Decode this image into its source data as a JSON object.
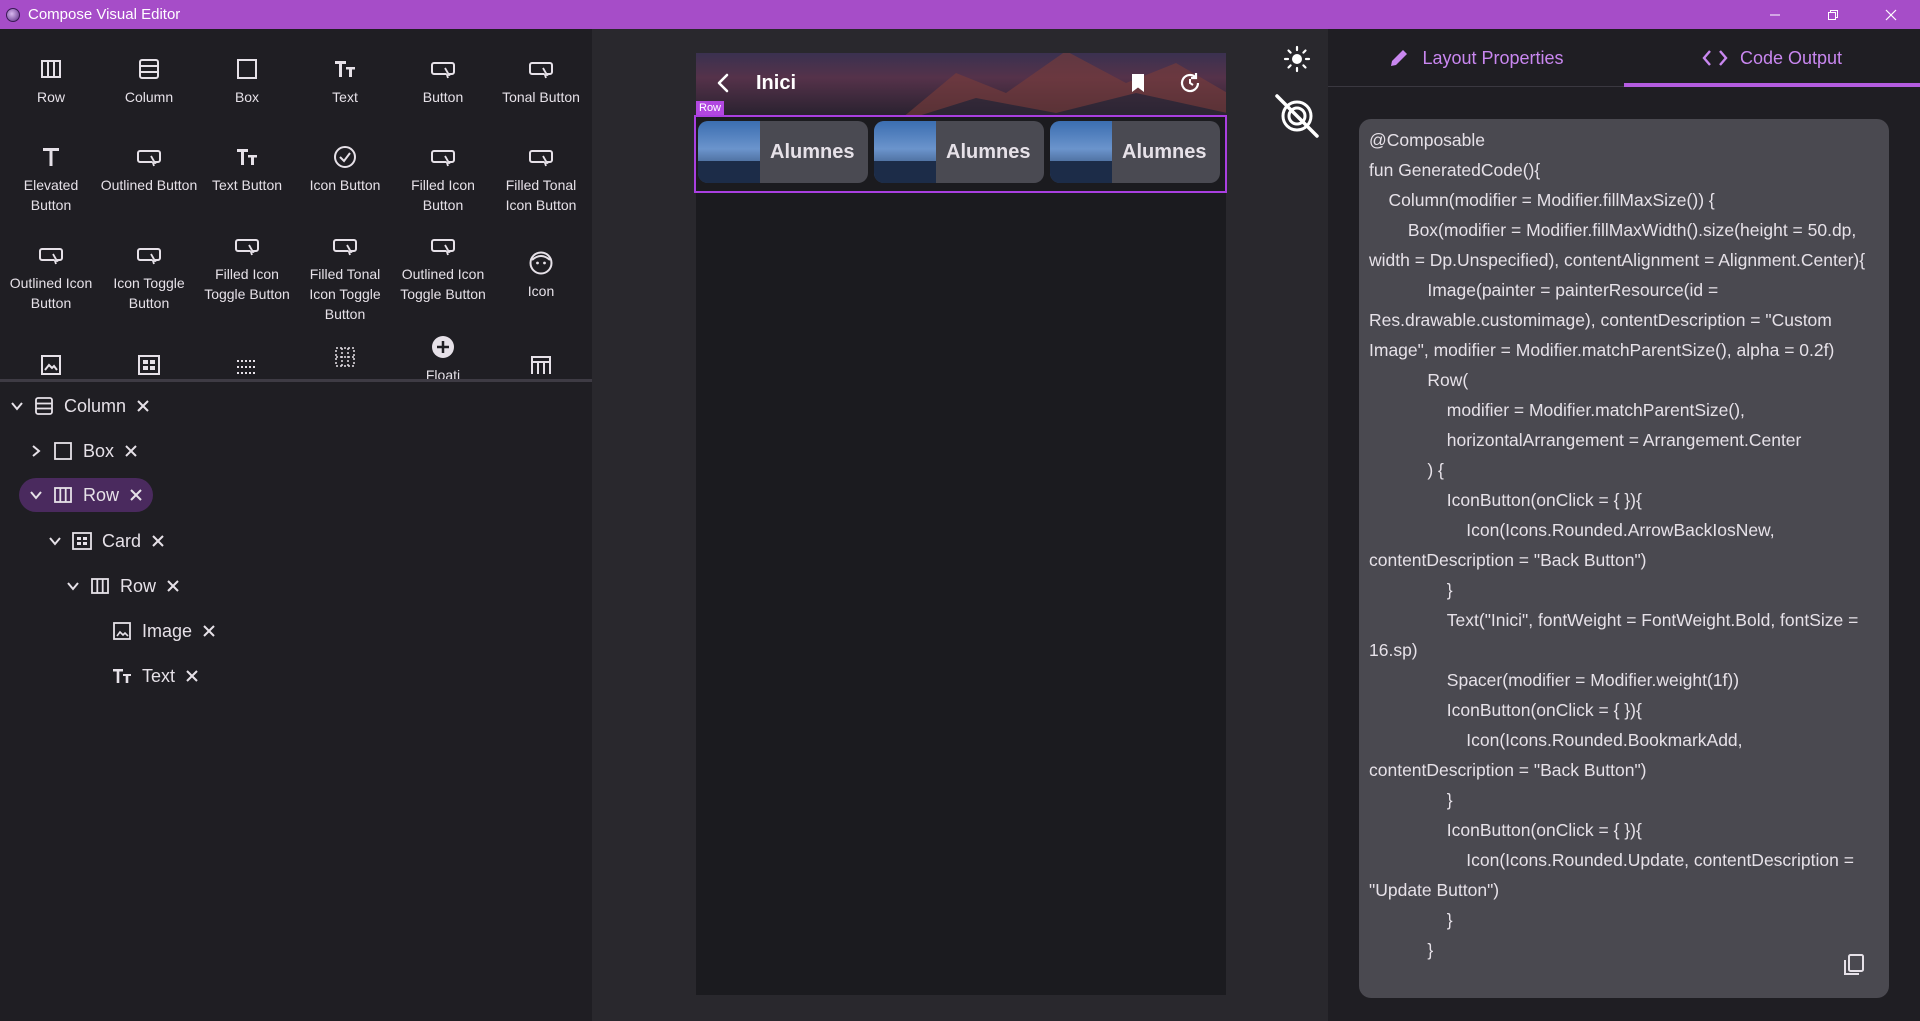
{
  "window": {
    "title": "Compose Visual Editor",
    "controls": [
      "minimize",
      "restore",
      "close"
    ]
  },
  "palette": {
    "items": [
      {
        "label": "Row",
        "icon": "row-icon"
      },
      {
        "label": "Column",
        "icon": "column-icon"
      },
      {
        "label": "Box",
        "icon": "box-icon"
      },
      {
        "label": "Text",
        "icon": "text-icon"
      },
      {
        "label": "Button",
        "icon": "button-icon"
      },
      {
        "label": "Tonal Button",
        "icon": "button-icon"
      },
      {
        "label": "Elevated Button",
        "icon": "text-t-icon"
      },
      {
        "label": "Outlined Button",
        "icon": "button-icon"
      },
      {
        "label": "Text Button",
        "icon": "text-icon"
      },
      {
        "label": "Icon Button",
        "icon": "check-circle-icon"
      },
      {
        "label": "Filled Icon Button",
        "icon": "button-icon"
      },
      {
        "label": "Filled Tonal Icon Button",
        "icon": "button-icon"
      },
      {
        "label": "Outlined Icon Button",
        "icon": "button-icon"
      },
      {
        "label": "Icon Toggle Button",
        "icon": "button-icon"
      },
      {
        "label": "Filled Icon Toggle Button",
        "icon": "button-icon"
      },
      {
        "label": "Filled Tonal Icon Toggle Button",
        "icon": "button-icon"
      },
      {
        "label": "Outlined Icon Toggle Button",
        "icon": "button-icon"
      },
      {
        "label": "Icon",
        "icon": "face-icon"
      },
      {
        "label": "",
        "icon": "image-icon"
      },
      {
        "label": "",
        "icon": "card-icon"
      },
      {
        "label": "",
        "icon": "grid-dots-icon"
      },
      {
        "label": "",
        "icon": "grid-icon"
      },
      {
        "label": "Floati",
        "icon": "add-circle-icon"
      },
      {
        "label": "",
        "icon": "table-icon"
      }
    ]
  },
  "tree": {
    "nodes": [
      {
        "label": "Column",
        "icon": "column-icon",
        "expanded": "down"
      },
      {
        "label": "Box",
        "icon": "box-icon",
        "expanded": "right"
      },
      {
        "label": "Row",
        "icon": "row-icon",
        "expanded": "down",
        "selected": true
      },
      {
        "label": "Card",
        "icon": "card-icon",
        "expanded": "down"
      },
      {
        "label": "Row",
        "icon": "row-icon",
        "expanded": "down"
      },
      {
        "label": "Image",
        "icon": "image-icon",
        "expanded": "none"
      },
      {
        "label": "Text",
        "icon": "text-icon",
        "expanded": "none"
      }
    ]
  },
  "preview": {
    "topbar_title": "Inici",
    "row_tag": "Row",
    "cards": [
      {
        "text": "Alumnes"
      },
      {
        "text": "Alumnes"
      },
      {
        "text": "Alumnes"
      }
    ]
  },
  "canvas_tools": [
    "sun-icon",
    "visibility-off-icon"
  ],
  "right_panel": {
    "tabs": [
      {
        "label": "Layout Properties",
        "icon": "pencil-icon",
        "active": false
      },
      {
        "label": "Code Output",
        "icon": "code-icon",
        "active": true
      }
    ],
    "code": "@Composable\nfun GeneratedCode(){\n    Column(modifier = Modifier.fillMaxSize()) {\n        Box(modifier = Modifier.fillMaxWidth().size(height = 50.dp, width = Dp.Unspecified), contentAlignment = Alignment.Center){\n            Image(painter = painterResource(id = Res.drawable.customimage), contentDescription = \"Custom Image\", modifier = Modifier.matchParentSize(), alpha = 0.2f)\n            Row(\n                modifier = Modifier.matchParentSize(),\n                horizontalArrangement = Arrangement.Center\n            ) {\n                IconButton(onClick = { }){\n                    Icon(Icons.Rounded.ArrowBackIosNew, contentDescription = \"Back Button\")\n                }\n                Text(\"Inici\", fontWeight = FontWeight.Bold, fontSize = 16.sp)\n                Spacer(modifier = Modifier.weight(1f))\n                IconButton(onClick = { }){\n                    Icon(Icons.Rounded.BookmarkAdd, contentDescription = \"Back Button\")\n                }\n                IconButton(onClick = { }){\n                    Icon(Icons.Rounded.Update, contentDescription = \"Update Button\")\n                }\n            }"
  }
}
